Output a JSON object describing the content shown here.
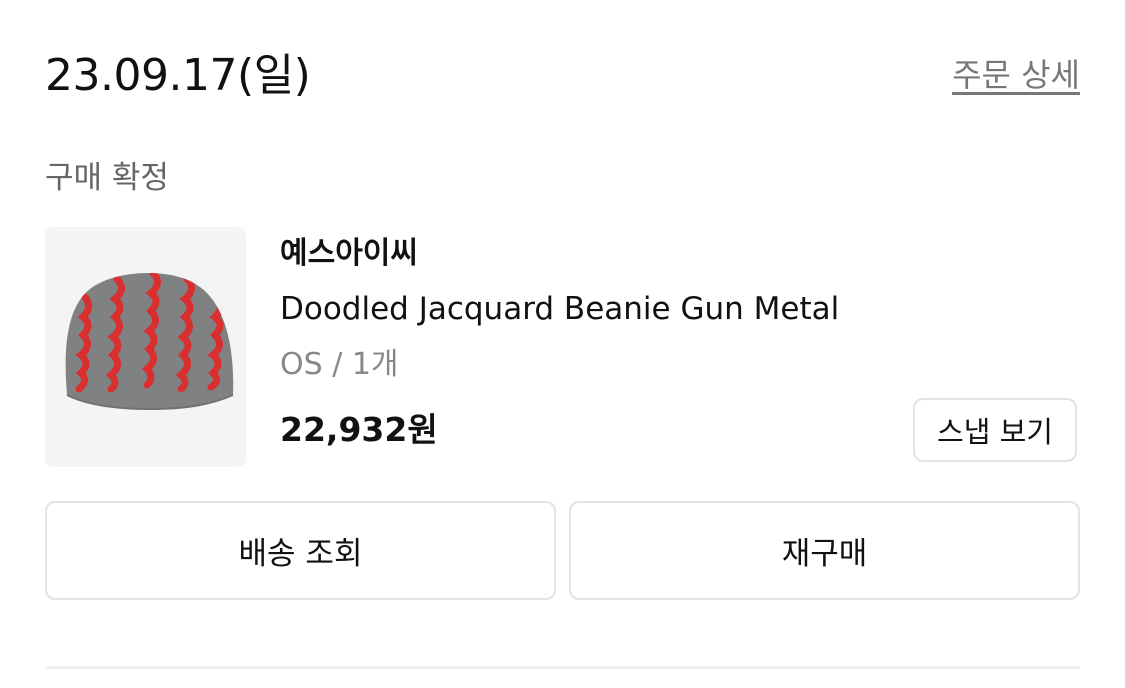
{
  "order": {
    "date": "23.09.17(일)",
    "detail_link": "주문 상세",
    "status": "구매 확정"
  },
  "product": {
    "image_icon": "beanie-image",
    "brand": "예스아이씨",
    "name": "Doodled Jacquard Beanie Gun Metal",
    "option": "OS / 1개",
    "price": "22,932원",
    "snap_button": "스냅 보기"
  },
  "actions": {
    "track_delivery": "배송 조회",
    "rebuy": "재구매"
  },
  "colors": {
    "beanie_body": "#7f8183",
    "beanie_pattern": "#d9302f",
    "thumb_bg": "#f4f4f4",
    "muted_text": "#777777",
    "border": "#e3e3e3"
  }
}
